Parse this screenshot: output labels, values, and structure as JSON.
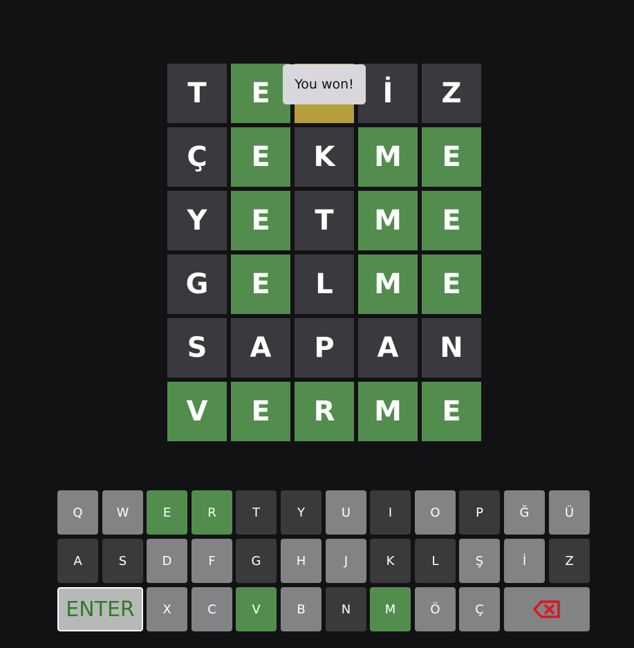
{
  "toast": {
    "message": "You won!"
  },
  "board": {
    "rows": [
      [
        {
          "letter": "T",
          "state": "absent"
        },
        {
          "letter": "E",
          "state": "correct"
        },
        {
          "letter": "",
          "state": "present"
        },
        {
          "letter": "İ",
          "state": "absent"
        },
        {
          "letter": "Z",
          "state": "absent"
        }
      ],
      [
        {
          "letter": "Ç",
          "state": "absent"
        },
        {
          "letter": "E",
          "state": "correct"
        },
        {
          "letter": "K",
          "state": "absent"
        },
        {
          "letter": "M",
          "state": "correct"
        },
        {
          "letter": "E",
          "state": "correct"
        }
      ],
      [
        {
          "letter": "Y",
          "state": "absent"
        },
        {
          "letter": "E",
          "state": "correct"
        },
        {
          "letter": "T",
          "state": "absent"
        },
        {
          "letter": "M",
          "state": "correct"
        },
        {
          "letter": "E",
          "state": "correct"
        }
      ],
      [
        {
          "letter": "G",
          "state": "absent"
        },
        {
          "letter": "E",
          "state": "correct"
        },
        {
          "letter": "L",
          "state": "absent"
        },
        {
          "letter": "M",
          "state": "correct"
        },
        {
          "letter": "E",
          "state": "correct"
        }
      ],
      [
        {
          "letter": "S",
          "state": "absent"
        },
        {
          "letter": "A",
          "state": "absent"
        },
        {
          "letter": "P",
          "state": "absent"
        },
        {
          "letter": "A",
          "state": "absent"
        },
        {
          "letter": "N",
          "state": "absent"
        }
      ],
      [
        {
          "letter": "V",
          "state": "correct"
        },
        {
          "letter": "E",
          "state": "correct"
        },
        {
          "letter": "R",
          "state": "correct"
        },
        {
          "letter": "M",
          "state": "correct"
        },
        {
          "letter": "E",
          "state": "correct"
        }
      ]
    ]
  },
  "keyboard": {
    "rows": [
      [
        {
          "label": "Q",
          "state": "unused"
        },
        {
          "label": "W",
          "state": "unused"
        },
        {
          "label": "E",
          "state": "correct"
        },
        {
          "label": "R",
          "state": "correct"
        },
        {
          "label": "T",
          "state": "absent"
        },
        {
          "label": "Y",
          "state": "absent"
        },
        {
          "label": "U",
          "state": "unused"
        },
        {
          "label": "I",
          "state": "absent"
        },
        {
          "label": "O",
          "state": "unused"
        },
        {
          "label": "P",
          "state": "absent"
        },
        {
          "label": "Ğ",
          "state": "unused"
        },
        {
          "label": "Ü",
          "state": "unused"
        }
      ],
      [
        {
          "label": "A",
          "state": "absent"
        },
        {
          "label": "S",
          "state": "absent"
        },
        {
          "label": "D",
          "state": "unused"
        },
        {
          "label": "F",
          "state": "unused"
        },
        {
          "label": "G",
          "state": "absent"
        },
        {
          "label": "H",
          "state": "unused"
        },
        {
          "label": "J",
          "state": "unused"
        },
        {
          "label": "K",
          "state": "absent"
        },
        {
          "label": "L",
          "state": "absent"
        },
        {
          "label": "Ş",
          "state": "unused"
        },
        {
          "label": "İ",
          "state": "unused"
        },
        {
          "label": "Z",
          "state": "absent"
        }
      ],
      [
        {
          "label": "ENTER",
          "state": "enter"
        },
        {
          "label": "X",
          "state": "unused"
        },
        {
          "label": "C",
          "state": "unused"
        },
        {
          "label": "V",
          "state": "correct"
        },
        {
          "label": "B",
          "state": "unused"
        },
        {
          "label": "N",
          "state": "absent"
        },
        {
          "label": "M",
          "state": "correct"
        },
        {
          "label": "Ö",
          "state": "unused"
        },
        {
          "label": "Ç",
          "state": "unused"
        },
        {
          "label": "",
          "state": "backspace",
          "icon": "backspace-icon"
        }
      ]
    ]
  },
  "colors": {
    "correct": "#538d4e",
    "present": "#b59f3b",
    "absent": "#3a3a3c",
    "unused": "#818384",
    "backspace_icon": "#e0151d",
    "enter_text": "#2e7d22"
  }
}
